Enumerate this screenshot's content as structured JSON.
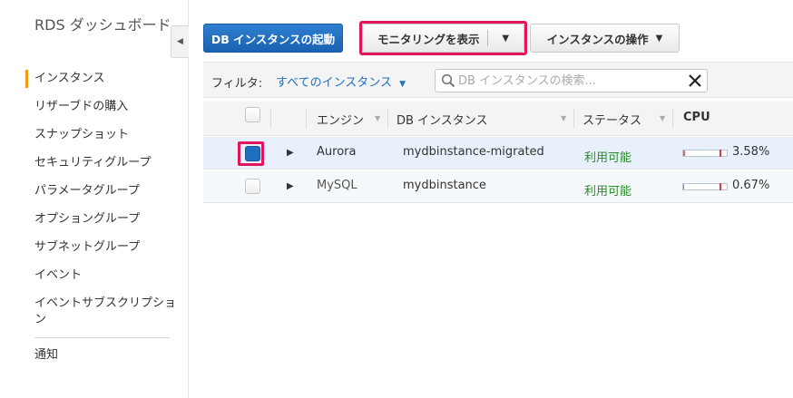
{
  "sidebar": {
    "title": "RDS ダッシュボード",
    "items": [
      {
        "label": "インスタンス",
        "active": true
      },
      {
        "label": "リザーブドの購入"
      },
      {
        "label": "スナップショット"
      },
      {
        "label": "セキュリティグループ"
      },
      {
        "label": "パラメータグループ"
      },
      {
        "label": "オプショングループ"
      },
      {
        "label": "サブネットグループ"
      },
      {
        "label": "イベント"
      },
      {
        "label": "イベントサブスクリプション"
      }
    ],
    "footer_item": "通知",
    "active_color": "#f39c12"
  },
  "toolbar": {
    "launch_label": "DB インスタンスの起動",
    "monitor_label": "モニタリングを表示",
    "ops_label": "インスタンスの操作"
  },
  "filter": {
    "label": "フィルタ:",
    "selected": "すべてのインスタンス",
    "search_placeholder": "DB インスタンスの検索..."
  },
  "table": {
    "headers": {
      "engine": "エンジン",
      "instance": "DB インスタンス",
      "status": "ステータス",
      "cpu": "CPU"
    },
    "rows": [
      {
        "engine": "Aurora",
        "instance": "mydbinstance-migrated",
        "status": "利用可能",
        "cpu": "3.58%",
        "cpu_value": 3.58,
        "selected": true
      },
      {
        "engine": "MySQL",
        "instance": "mydbinstance",
        "status": "利用可能",
        "cpu": "0.67%",
        "cpu_value": 0.67,
        "selected": false
      }
    ]
  },
  "colors": {
    "primary": "#1b62b2",
    "highlight": "#e3165b",
    "status_ok": "#2a8a2a",
    "link": "#1f6fbf"
  }
}
